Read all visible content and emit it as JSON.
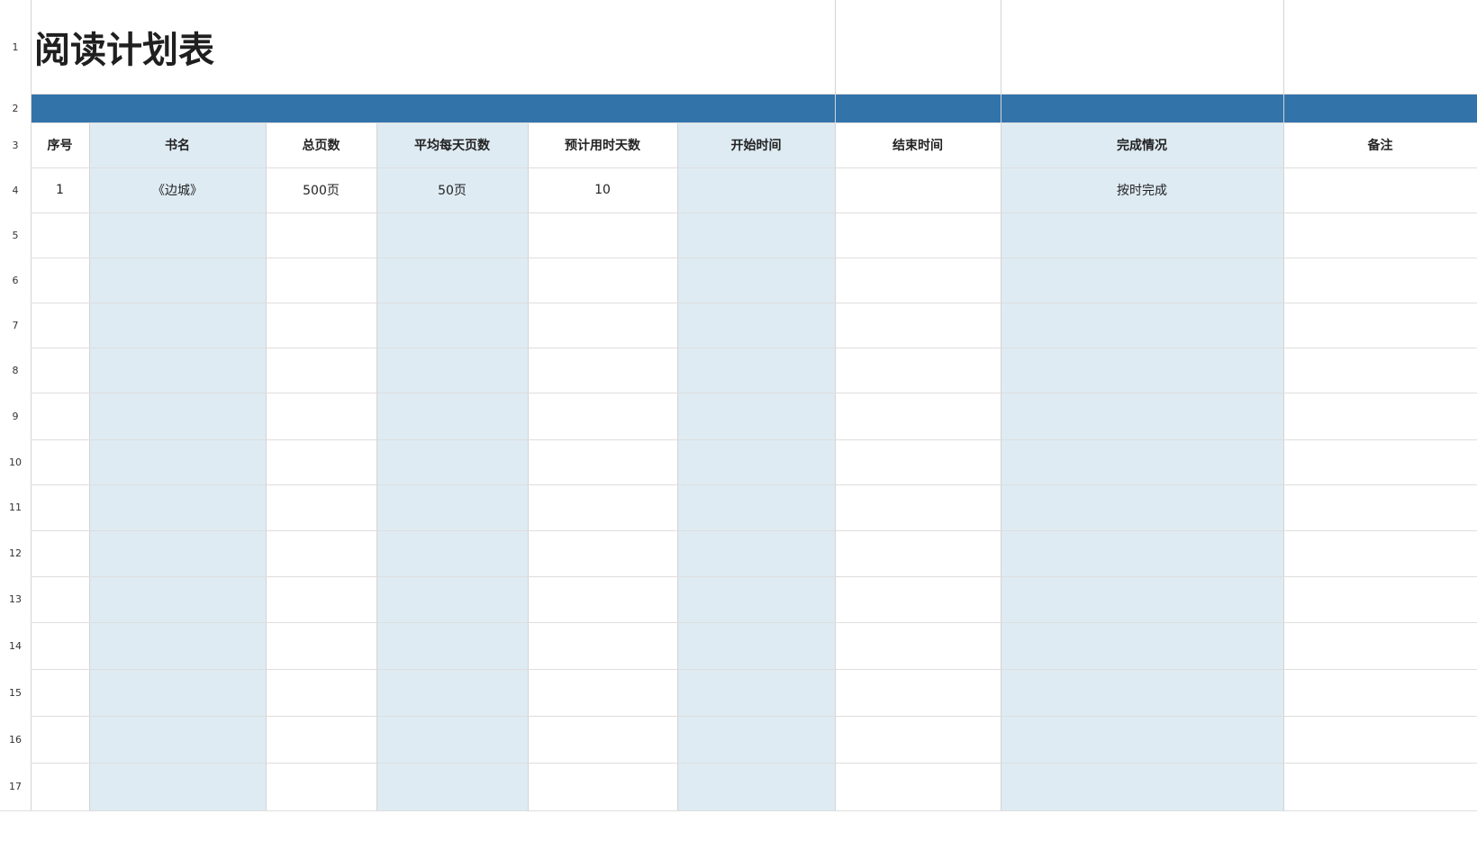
{
  "sheet": {
    "title": "阅读计划表",
    "accent_color": "#3273aa",
    "highlight_color": "#deebf3",
    "row_numbers": [
      "1",
      "2",
      "3",
      "4",
      "5",
      "6",
      "7",
      "8",
      "9",
      "10",
      "11",
      "12",
      "13",
      "14",
      "15",
      "16",
      "17"
    ],
    "columns": [
      "序号",
      "书名",
      "总页数",
      "平均每天页数",
      "预计用时天数",
      "开始时间",
      "结束时间",
      "完成情况",
      "备注"
    ],
    "highlighted_columns": [
      1,
      3,
      5,
      7
    ],
    "rows": [
      [
        "1",
        "《边城》",
        "500页",
        "50页",
        "10",
        "",
        "",
        "按时完成",
        ""
      ]
    ]
  }
}
